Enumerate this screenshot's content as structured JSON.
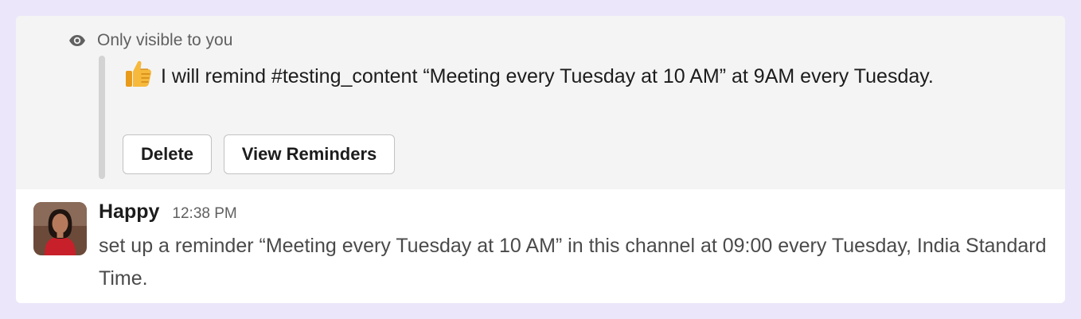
{
  "ephemeral": {
    "visibility_label": "Only visible to you",
    "message": "I will remind #testing_content “Meeting every Tuesday at 10 AM” at 9AM every Tuesday.",
    "buttons": {
      "delete_label": "Delete",
      "view_reminders_label": "View Reminders"
    }
  },
  "message": {
    "author": "Happy",
    "timestamp": "12:38 PM",
    "text": "set up a reminder “Meeting every Tuesday at 10 AM” in this channel at 09:00 every Tuesday, India Standard Time."
  },
  "icons": {
    "visibility": "eye-icon",
    "reaction": "thumbs-up-icon",
    "author_avatar": "avatar"
  },
  "colors": {
    "page_background": "#ece6fb",
    "ephemeral_background": "#f4f4f4",
    "quote_bar": "#d3d3d3",
    "thumbs_up": "#f6b93b"
  }
}
